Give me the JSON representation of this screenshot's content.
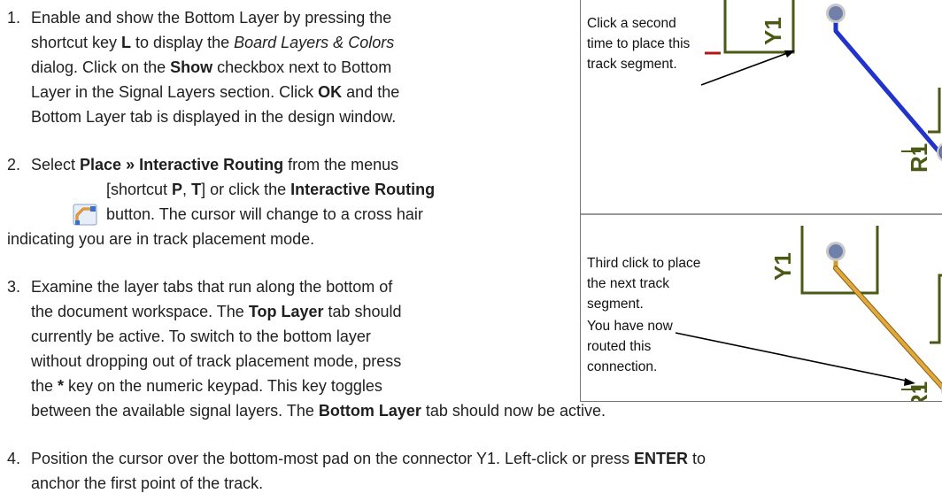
{
  "steps": [
    {
      "number": "1.",
      "lines": [
        [
          {
            "t": "Enable and show the Bottom Layer by pressing the"
          }
        ],
        [
          {
            "t": "shortcut key "
          },
          {
            "t": "L",
            "s": "b"
          },
          {
            "t": " to display the "
          },
          {
            "t": "Board Layers & Colors",
            "s": "i"
          }
        ],
        [
          {
            "t": "dialog. Click on the "
          },
          {
            "t": "Show",
            "s": "b"
          },
          {
            "t": " checkbox next to Bottom"
          }
        ],
        [
          {
            "t": "Layer in the Signal Layers section. Click "
          },
          {
            "t": "OK",
            "s": "b"
          },
          {
            "t": " and the"
          }
        ],
        [
          {
            "t": "Bottom Layer tab is displayed in the design window."
          }
        ]
      ]
    },
    {
      "number": "2.",
      "lines": [
        [
          {
            "t": "Select "
          },
          {
            "t": "Place",
            "s": "b"
          },
          {
            "t": " » ",
            "s": "b"
          },
          {
            "t": "Interactive Routing",
            "s": "b"
          },
          {
            "t": " from the menus"
          }
        ],
        [
          {
            "t": "[shortcut "
          },
          {
            "t": "P",
            "s": "b"
          },
          {
            "t": ", "
          },
          {
            "t": "T",
            "s": "b"
          },
          {
            "t": "] or click the "
          },
          {
            "t": "Interactive Routing",
            "s": "b"
          }
        ],
        [
          {
            "t": "button. The cursor will change to a cross hair"
          }
        ],
        [
          {
            "t": "indicating you are in track placement mode."
          }
        ]
      ]
    },
    {
      "number": "3.",
      "lines": [
        [
          {
            "t": "Examine the layer tabs that run along the bottom of"
          }
        ],
        [
          {
            "t": "the document workspace. The "
          },
          {
            "t": "Top Layer",
            "s": "b"
          },
          {
            "t": " tab should"
          }
        ],
        [
          {
            "t": "currently be active. To switch to the bottom layer"
          }
        ],
        [
          {
            "t": "without dropping out of track placement  mode, press"
          }
        ],
        [
          {
            "t": "the "
          },
          {
            "t": "*",
            "s": "b"
          },
          {
            "t": " key on the numeric keypad. This key toggles"
          }
        ],
        [
          {
            "t": "between the available signal layers. The "
          },
          {
            "t": "Bottom Layer",
            "s": "b"
          },
          {
            "t": " tab should now be active."
          }
        ]
      ]
    },
    {
      "number": "4.",
      "lines": [
        [
          {
            "t": "Position the cursor over the bottom-most pad on the connector Y1. Left-click or press "
          },
          {
            "t": "ENTER",
            "s": "b"
          },
          {
            "t": " to"
          }
        ],
        [
          {
            "t": "anchor the first point of the track."
          }
        ]
      ]
    }
  ],
  "icons": {
    "routing_tool": "interactive-routing-icon"
  },
  "figure": {
    "top_panel": {
      "caption_lines": [
        "Click a second",
        "time to place this",
        "track segment."
      ],
      "labels": {
        "connector": "Y1",
        "resistor": "R1"
      },
      "track_color": "#2233cc"
    },
    "bottom_panel": {
      "caption_lines": [
        "Third click to place",
        "the next track",
        "segment.",
        "You have now",
        "routed this",
        "connection."
      ],
      "labels": {
        "connector": "Y1",
        "resistor": "R1"
      },
      "track_color": "#d39a2a"
    },
    "colors": {
      "silkscreen": "#4a5a14",
      "pad_fill": "#7080a8",
      "pad_ring": "#c8c8c8",
      "border": "#777777"
    }
  }
}
